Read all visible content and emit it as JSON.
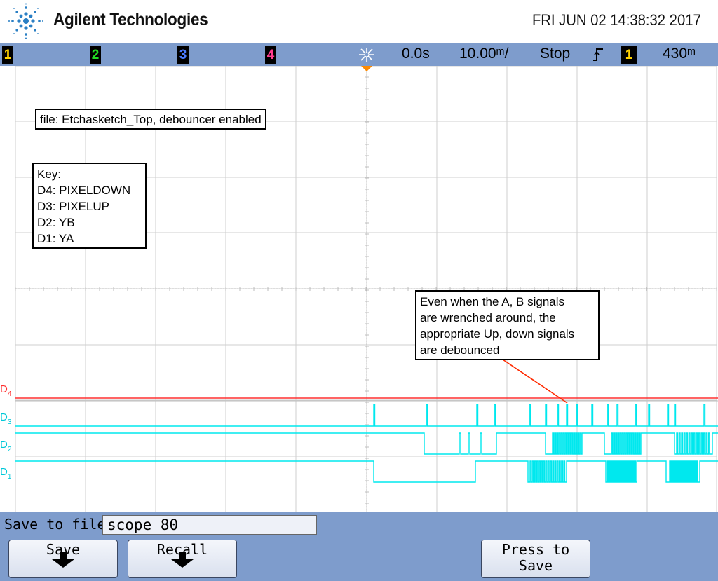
{
  "header": {
    "brand": "Agilent Technologies",
    "datetime": "FRI JUN 02 14:38:32 2017",
    "logo_icon": "agilent-spark-icon"
  },
  "status_bar": {
    "channels": [
      "1",
      "2",
      "3",
      "4"
    ],
    "channel_colors": [
      "#ffd200",
      "#22dd22",
      "#4b7bff",
      "#ff3b8f"
    ],
    "delay": "0.0s",
    "timebase": "10.00ᵐ/",
    "run_state": "Stop",
    "trigger_channel": "1",
    "trigger_level": "430ᵐ",
    "trigger_slope_icon": "rising-edge-icon",
    "acquire_icon": "acquisition-starburst-icon"
  },
  "annotations": {
    "file_note": "file: Etchasketch_Top, debouncer enabled",
    "key_title": "Key:",
    "key_lines": [
      "D4: PIXELDOWN",
      "D3: PIXELUP",
      "D2: YB",
      "D1: YA"
    ],
    "comment_lines": [
      "Even when the A, B signals",
      "are wrenched around, the",
      "appropriate Up, down signals",
      "are debounced"
    ]
  },
  "traces": {
    "labels": [
      "D4",
      "D3",
      "D2",
      "D1"
    ],
    "colors": {
      "D4": "#ff3030",
      "D3": "#00e8ee",
      "D2": "#00e8ee",
      "D1": "#00e8ee"
    }
  },
  "bottom": {
    "save_label": "Save to file =",
    "file_name": "scope_80",
    "softkeys": [
      "Save",
      "Recall",
      "Press to",
      "Save"
    ]
  }
}
